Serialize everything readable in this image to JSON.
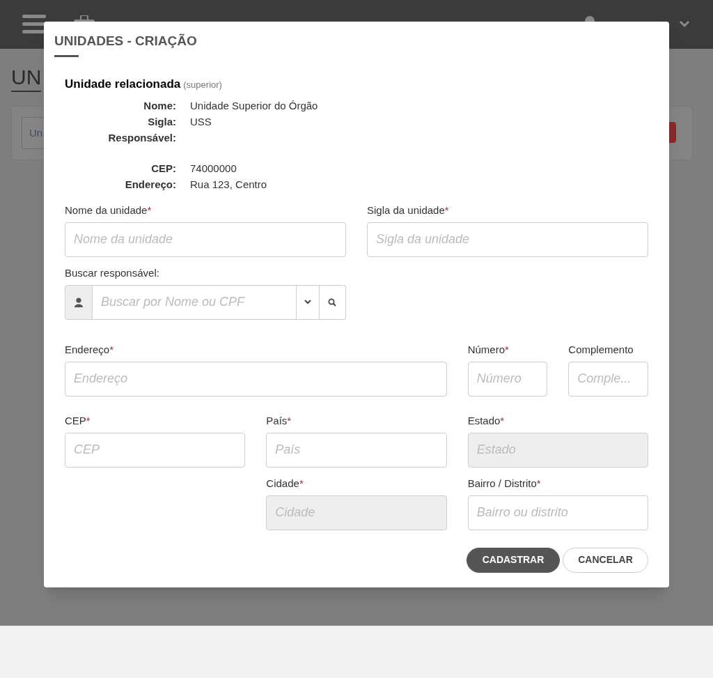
{
  "background_page": {
    "heading": "UN",
    "filter_value": "Un"
  },
  "modal": {
    "title": "UNIDADES - CRIAÇÃO",
    "section": {
      "title": "Unidade relacionada",
      "note": "(superior)",
      "detail_groups": [
        [
          {
            "label": "Nome:",
            "value": "Unidade Superior do Órgão"
          },
          {
            "label": "Sigla:",
            "value": "USS"
          },
          {
            "label": "Responsável:"
          }
        ],
        [
          {
            "label": "CEP:",
            "value": "74000000"
          },
          {
            "label": "Endereço:",
            "value": "Rua 123, Centro"
          }
        ]
      ]
    },
    "fields": [
      {
        "kind": "text",
        "label": "Nome da unidade",
        "required_mark": "*",
        "placeholder": "Nome da unidade",
        "disabled": false
      },
      {
        "kind": "text",
        "label": "Sigla da unidade",
        "required_mark": "*",
        "placeholder": "Sigla da unidade",
        "disabled": false
      },
      {
        "kind": "search",
        "label": "Buscar responsável:",
        "placeholder": "Buscar por Nome ou CPF",
        "disabled": false
      },
      {
        "kind": "text",
        "label": "Endereço",
        "required_mark": "*",
        "placeholder": "Endereço",
        "disabled": false
      },
      {
        "kind": "text",
        "label": "Número",
        "required_mark": "*",
        "placeholder": "Número",
        "disabled": false
      },
      {
        "kind": "text",
        "label": "Complemento",
        "placeholder": "Comple...",
        "disabled": false
      },
      {
        "kind": "text",
        "label": "CEP",
        "required_mark": "*",
        "placeholder": "CEP",
        "disabled": false
      },
      {
        "kind": "text",
        "label": "País",
        "required_mark": "*",
        "placeholder": "País",
        "disabled": false
      },
      {
        "kind": "text",
        "label": "Estado",
        "required_mark": "*",
        "placeholder": "Estado",
        "disabled": true
      },
      {
        "kind": "text",
        "label": "Cidade",
        "required_mark": "*",
        "placeholder": "Cidade",
        "disabled": true
      },
      {
        "kind": "text",
        "label": "Bairro / Distrito",
        "required_mark": "*",
        "placeholder": "Bairro ou distrito",
        "disabled": false
      }
    ],
    "buttons": [
      {
        "kind": "primary",
        "label": "CADASTRAR"
      },
      {
        "kind": "secondary",
        "label": "CANCELAR"
      }
    ]
  }
}
